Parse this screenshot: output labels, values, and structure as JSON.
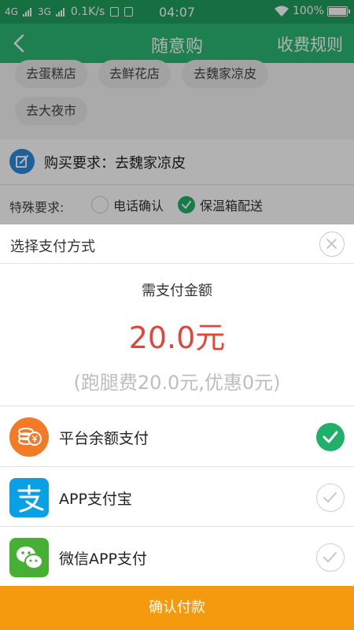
{
  "status_bar": {
    "net1": "4G",
    "net2": "3G",
    "speed": "0.1K/s",
    "time": "04:07",
    "battery": "100%"
  },
  "nav": {
    "title": "随意购",
    "right_link": "收费规则"
  },
  "background": {
    "chips": [
      "去蛋糕店",
      "去鲜花店",
      "去魏家凉皮",
      "去大夜市"
    ],
    "requirement_label": "购买要求：",
    "requirement_value": "去魏家凉皮",
    "special_label": "特殊要求:",
    "options": [
      {
        "label": "电话确认",
        "checked": false
      },
      {
        "label": "保温箱配送",
        "checked": true
      }
    ]
  },
  "sheet": {
    "title": "选择支付方式",
    "need_label": "需支付金额",
    "amount": "20.0元",
    "detail": "(跑腿费20.0元,优惠0元)",
    "methods": [
      {
        "label": "平台余额支付",
        "icon": "wallet-icon",
        "selected": true
      },
      {
        "label": "APP支付宝",
        "icon": "alipay-icon",
        "selected": false
      },
      {
        "label": "微信APP支付",
        "icon": "wechat-icon",
        "selected": false
      }
    ],
    "confirm_label": "确认付款"
  },
  "colors": {
    "nav_green": "#2bb673",
    "amount_red": "#e0463a",
    "confirm_orange": "#f59a0e",
    "check_green": "#21b06a"
  }
}
